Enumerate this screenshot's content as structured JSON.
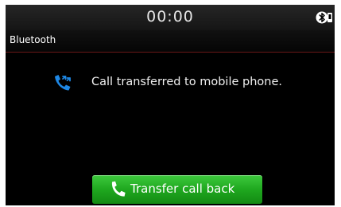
{
  "status_bar": {
    "time": "00:00",
    "bluetooth_icon": "bluetooth-connected-icon"
  },
  "title_bar": {
    "title": "Bluetooth"
  },
  "message": {
    "icon": "call-transfer-icon",
    "text": "Call transferred to mobile phone."
  },
  "transfer_button": {
    "icon": "phone-handset-icon",
    "label": "Transfer call back"
  },
  "colors": {
    "accent_blue": "#1e88e5",
    "button_green": "#1fa81f",
    "title_divider": "#6a1818"
  }
}
